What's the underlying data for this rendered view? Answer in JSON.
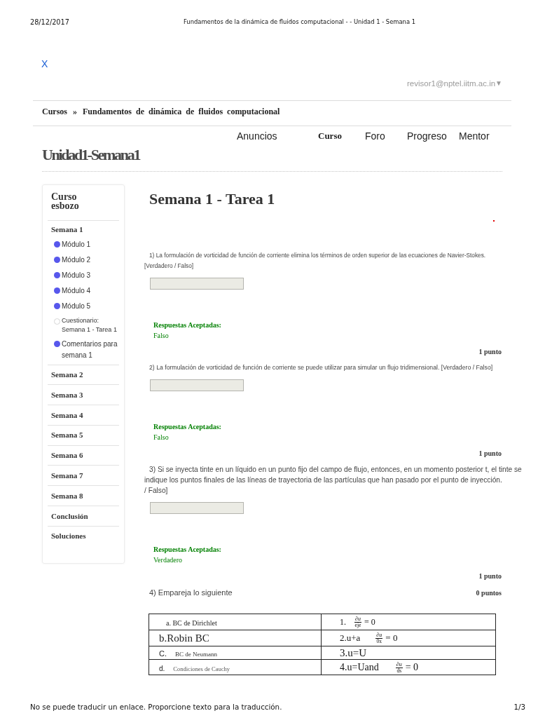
{
  "print_header": {
    "date": "28/12/2017",
    "title": "Fundamentos de la dinámica de fluidos computacional - - Unidad 1 - Semana 1"
  },
  "close_link": "X",
  "user_menu": {
    "email": "revisor1@nptel.iitm.ac.in",
    "caret": "▼"
  },
  "breadcrumb": {
    "link": "Cursos",
    "separator": "»",
    "current": "Fundamentos de dinámica de fluidos computacional"
  },
  "nav_tabs": [
    {
      "label": "Anuncios",
      "selected": false
    },
    {
      "label": "Curso",
      "selected": true
    },
    {
      "label": "Foro",
      "selected": false
    },
    {
      "label": "Progreso",
      "selected": false
    },
    {
      "label": "Mentor",
      "selected": false
    }
  ],
  "unit_title": "Unidad1-Semana1",
  "sidebar": {
    "title": "Curso esbozo",
    "sections": [
      {
        "label": "Semana 1",
        "children": [
          {
            "label": "Módulo 1",
            "kind": "module",
            "completed": true
          },
          {
            "label": "Módulo 2",
            "kind": "module",
            "completed": true
          },
          {
            "label": "Módulo 3",
            "kind": "module",
            "completed": true
          },
          {
            "label": "Módulo 4",
            "kind": "module",
            "completed": true
          },
          {
            "label": "Módulo 5",
            "kind": "module",
            "completed": true
          },
          {
            "label": "Cuestionario: Semana 1 - Tarea 1",
            "kind": "quiz",
            "completed": false
          },
          {
            "label": "Comentarios para semana 1",
            "kind": "module",
            "completed": true
          }
        ]
      },
      {
        "label": "Semana 2"
      },
      {
        "label": "Semana 3"
      },
      {
        "label": "Semana 4"
      },
      {
        "label": "Semana 5"
      },
      {
        "label": "Semana 6"
      },
      {
        "label": "Semana 7"
      },
      {
        "label": "Semana 8"
      },
      {
        "label": "Conclusión"
      },
      {
        "label": "Soluciones"
      }
    ]
  },
  "assignment": {
    "title": "Semana 1 - Tarea 1",
    "questions": [
      {
        "kind": "text_answer",
        "text": "1) La formulación de vorticidad de función de corriente elimina los términos de orden superior de las ecuaciones de Navier-Stokes.\n[Verdadero / Falso]",
        "field": {
          "disabled": true
        },
        "answer_label": "Respuestas Aceptadas:",
        "answer": "Falso",
        "score": "1 punto"
      },
      {
        "kind": "text_answer",
        "text": "2) La formulación de vorticidad de función de corriente se puede utilizar para simular un flujo tridimensional. [Verdadero / Falso]",
        "field": {
          "disabled": true
        },
        "answer_label": "Respuestas Aceptadas:",
        "answer": "Falso",
        "score": "1 punto"
      },
      {
        "kind": "text_answer",
        "text": "3) Si se inyecta tinte en un líquido en un punto fijo del campo de flujo, entonces, en un momento posterior t, el tinte se\nindique los puntos finales de las líneas de trayectoria de las partículas que han pasado por el punto de inyección.\n/ Falso]",
        "field": {
          "disabled": true
        },
        "answer_label": "Respuestas Aceptadas:",
        "answer": "Verdadero",
        "score": "1 punto"
      },
      {
        "kind": "matching",
        "text": "4) Empareja lo siguiente",
        "score": "0 puntos",
        "table": {
          "rows": [
            {
              "left": {
                "text": "a. BC de Dirichlet"
              },
              "right": {
                "prefix": "1.",
                "numerator": "∂u",
                "denominator": "eje",
                "suffix": "= 0"
              }
            },
            {
              "left": {
                "text": "b.Robin BC"
              },
              "right": {
                "prefix": "2.u+a",
                "numerator": "∂u",
                "denominator": "0x",
                "suffix": "= 0"
              }
            },
            {
              "left": {
                "marker": "C.",
                "text": "BC de Neumann"
              },
              "right": {
                "prefix": "3.u=U"
              }
            },
            {
              "left": {
                "marker": "d.",
                "text": "Condiciones de Cauchy"
              },
              "right": {
                "prefix": "4.u=Uand",
                "numerator": "∂u",
                "denominator": "ds",
                "suffix": "= 0"
              }
            }
          ]
        }
      }
    ]
  },
  "print_footer": {
    "note": "No se puede traducir un enlace. Proporcione texto para la traducción.",
    "page": "1/3"
  }
}
